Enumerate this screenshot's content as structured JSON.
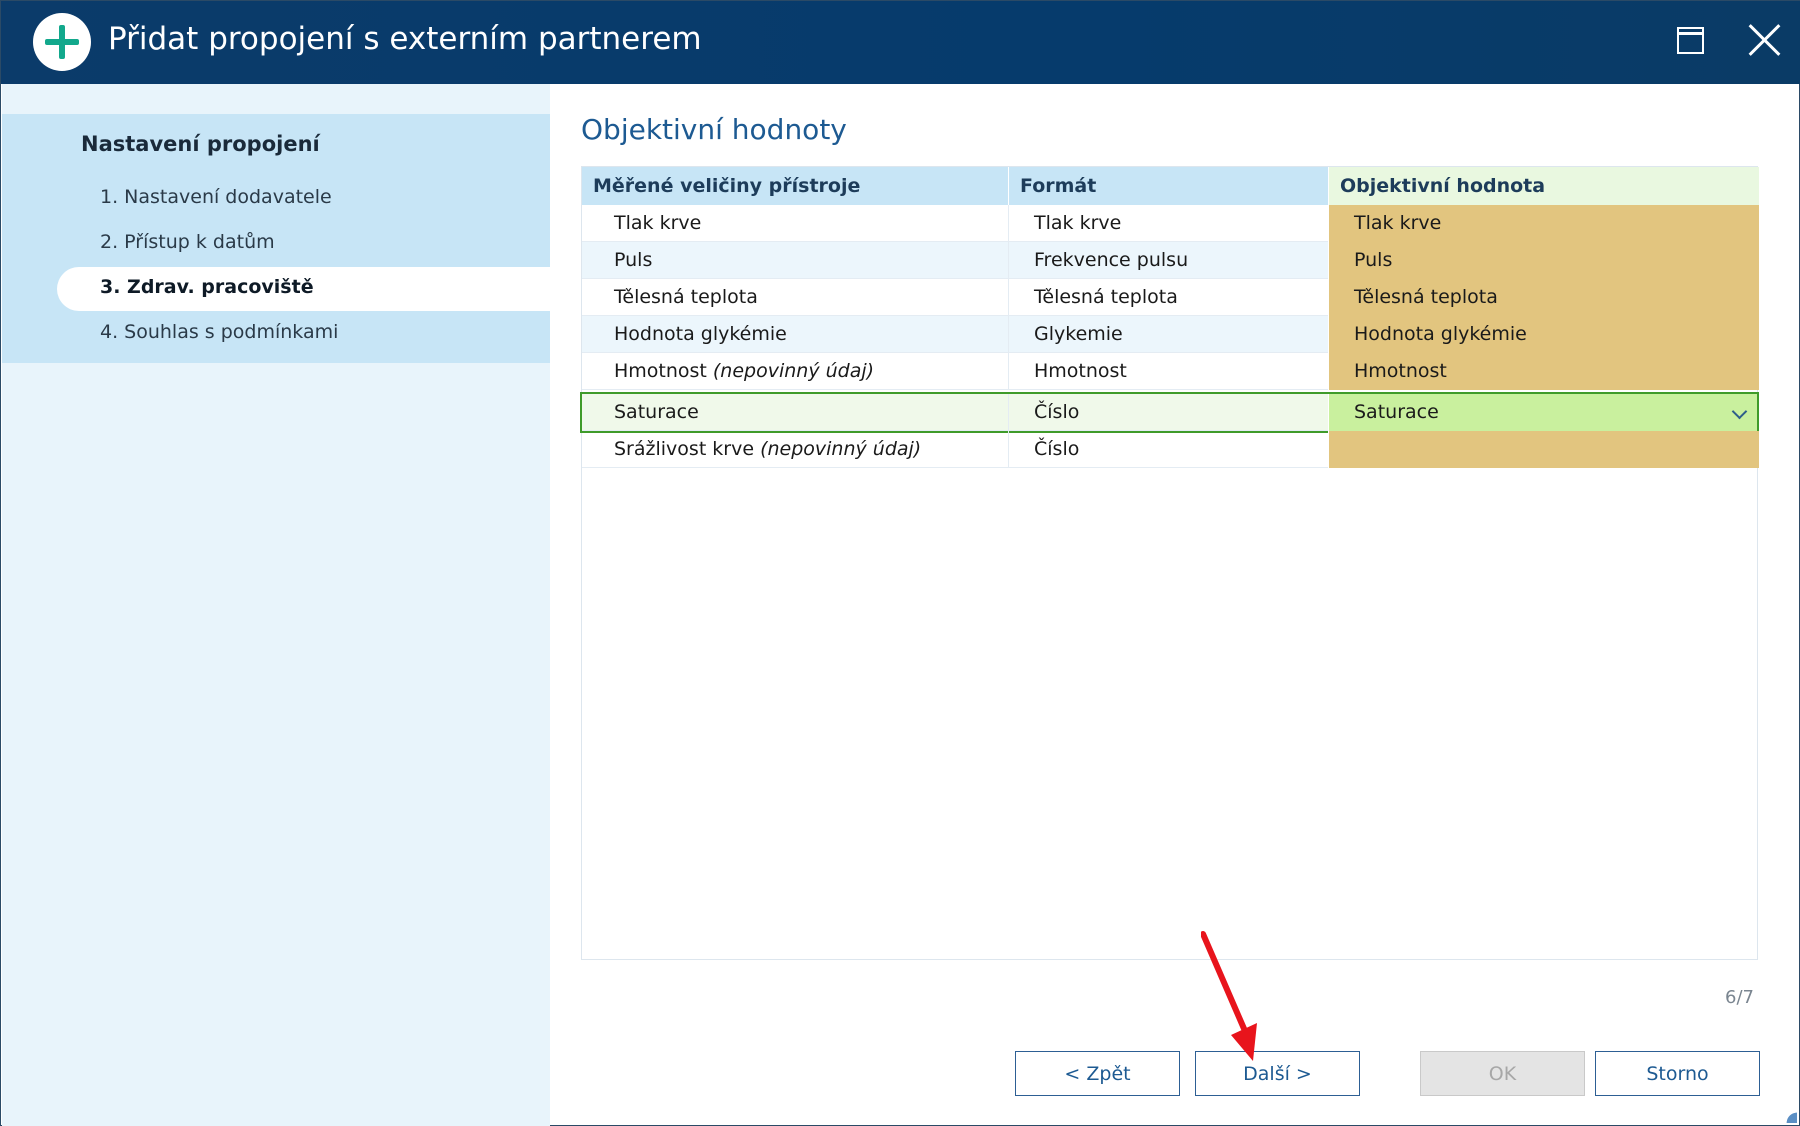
{
  "window": {
    "title": "Přidat propojení s externím partnerem"
  },
  "sidebar": {
    "heading": "Nastavení propojení",
    "steps": [
      {
        "label": "1. Nastavení dodavatele",
        "active": false
      },
      {
        "label": "2. Přístup k datům",
        "active": false
      },
      {
        "label": "3. Zdrav. pracoviště",
        "active": true
      },
      {
        "label": "4. Souhlas s podmínkami",
        "active": false
      }
    ]
  },
  "main": {
    "section_title": "Objektivní hodnoty",
    "table": {
      "columns": [
        "Měřené veličiny přístroje",
        "Formát",
        "Objektivní hodnota"
      ],
      "rows": [
        {
          "measure": "Tlak krve",
          "optional": "",
          "format": "Tlak krve",
          "value": "Tlak krve"
        },
        {
          "measure": "Puls",
          "optional": "",
          "format": "Frekvence pulsu",
          "value": "Puls"
        },
        {
          "measure": "Tělesná teplota",
          "optional": "",
          "format": "Tělesná teplota",
          "value": "Tělesná teplota"
        },
        {
          "measure": "Hodnota glykémie",
          "optional": "",
          "format": "Glykemie",
          "value": "Hodnota glykémie"
        },
        {
          "measure": "Hmotnost",
          "optional": "(nepovinný údaj)",
          "format": "Hmotnost",
          "value": "Hmotnost"
        },
        {
          "measure": "Saturace",
          "optional": "",
          "format": "Číslo",
          "value": "Saturace"
        },
        {
          "measure": "Srážlivost krve",
          "optional": "(nepovinný údaj)",
          "format": "Číslo",
          "value": ""
        }
      ],
      "selected_row_index": 5
    },
    "page_counter": "6/7"
  },
  "buttons": {
    "back": "< Zpět",
    "next": "Další >",
    "ok": "OK",
    "cancel": "Storno"
  },
  "colors": {
    "titlebar": "#063b6c",
    "accent": "#1d5a92",
    "value_cell": "#e2c57f",
    "selected_value_cell": "#c9f09e",
    "selection_border": "#3f9b2a",
    "annotation_arrow": "#e8141c"
  }
}
